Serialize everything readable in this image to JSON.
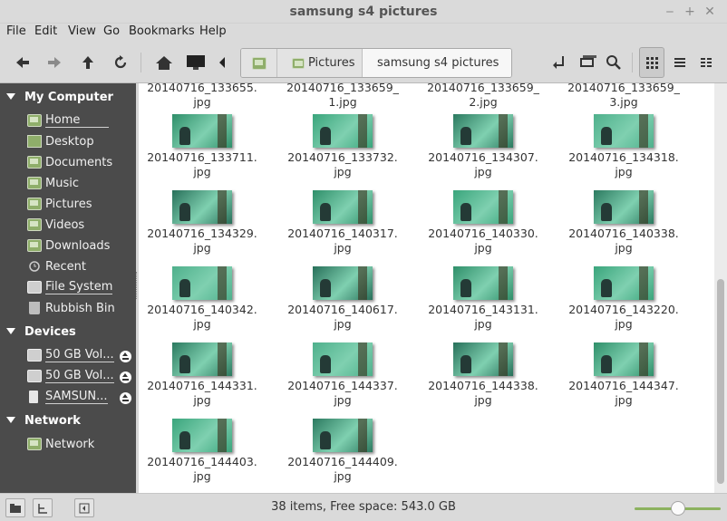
{
  "window": {
    "title": "samsung s4 pictures"
  },
  "menu": [
    "File",
    "Edit",
    "View",
    "Go",
    "Bookmarks",
    "Help"
  ],
  "toolbar": {
    "crumbs": [
      "Pictures",
      "samsung s4 pictures"
    ]
  },
  "sidebar": {
    "sections": [
      {
        "label": "My Computer",
        "items": [
          "Home",
          "Desktop",
          "Documents",
          "Music",
          "Pictures",
          "Videos",
          "Downloads",
          "Recent",
          "File System",
          "Rubbish Bin"
        ]
      },
      {
        "label": "Devices",
        "items": [
          "50 GB Vol...",
          "50 GB Vol...",
          "SAMSUN..."
        ]
      },
      {
        "label": "Network",
        "items": [
          "Network"
        ]
      }
    ]
  },
  "files": {
    "partial_row": [
      "20140716_133655.\njpg",
      "20140716_133659_\n1.jpg",
      "20140716_133659_\n2.jpg",
      "20140716_133659_\n3.jpg"
    ],
    "rows": [
      [
        "20140716_133711.",
        "20140716_133732.",
        "20140716_134307.",
        "20140716_134318."
      ],
      [
        "20140716_134329.",
        "20140716_140317.",
        "20140716_140330.",
        "20140716_140338."
      ],
      [
        "20140716_140342.",
        "20140716_140617.",
        "20140716_143131.",
        "20140716_143220."
      ],
      [
        "20140716_144331.",
        "20140716_144337.",
        "20140716_144338.",
        "20140716_144347."
      ],
      [
        "20140716_144403.",
        "20140716_144409."
      ]
    ],
    "ext": "jpg"
  },
  "status": {
    "text": "38 items, Free space: 543.0 GB",
    "zoom_fraction": 0.45
  },
  "colors": {
    "sidebar": "#4b4b4b",
    "accent": "#8cb25f",
    "content": "#ffffff"
  }
}
